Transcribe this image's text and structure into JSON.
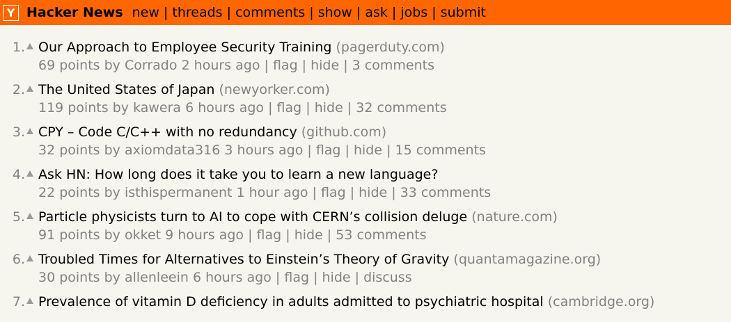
{
  "header": {
    "logo": "Y",
    "site_name": "Hacker News",
    "nav": [
      "new",
      "threads",
      "comments",
      "show",
      "ask",
      "jobs",
      "submit"
    ],
    "bg_color": "#ff6600"
  },
  "stories": [
    {
      "rank": "1.",
      "title": "Our Approach to Employee Security Training",
      "domain": "(pagerduty.com)",
      "points": "69 points",
      "by": "by",
      "user": "Corrado",
      "age": "2 hours ago",
      "flag": "flag",
      "hide": "hide",
      "comments": "3 comments"
    },
    {
      "rank": "2.",
      "title": "The United States of Japan",
      "domain": "(newyorker.com)",
      "points": "119 points",
      "by": "by",
      "user": "kawera",
      "age": "6 hours ago",
      "flag": "flag",
      "hide": "hide",
      "comments": "32 comments"
    },
    {
      "rank": "3.",
      "title": "CPY – Code C/C++ with no redundancy",
      "domain": "(github.com)",
      "points": "32 points",
      "by": "by",
      "user": "axiomdata316",
      "age": "3 hours ago",
      "flag": "flag",
      "hide": "hide",
      "comments": "15 comments"
    },
    {
      "rank": "4.",
      "title": "Ask HN: How long does it take you to learn a new language?",
      "domain": "",
      "points": "22 points",
      "by": "by",
      "user": "isthispermanent",
      "age": "1 hour ago",
      "flag": "flag",
      "hide": "hide",
      "comments": "33 comments"
    },
    {
      "rank": "5.",
      "title": "Particle physicists turn to AI to cope with CERN’s collision deluge",
      "domain": "(nature.com)",
      "points": "91 points",
      "by": "by",
      "user": "okket",
      "age": "9 hours ago",
      "flag": "flag",
      "hide": "hide",
      "comments": "53 comments"
    },
    {
      "rank": "6.",
      "title": "Troubled Times for Alternatives to Einstein’s Theory of Gravity",
      "domain": "(quantamagazine.org)",
      "points": "30 points",
      "by": "by",
      "user": "allenleein",
      "age": "6 hours ago",
      "flag": "flag",
      "hide": "hide",
      "comments": "discuss"
    },
    {
      "rank": "7.",
      "title": "Prevalence of vitamin D deficiency in adults admitted to psychiatric hospital",
      "domain": "(cambridge.org)",
      "points": "",
      "by": "",
      "user": "",
      "age": "",
      "flag": "",
      "hide": "",
      "comments": ""
    }
  ]
}
